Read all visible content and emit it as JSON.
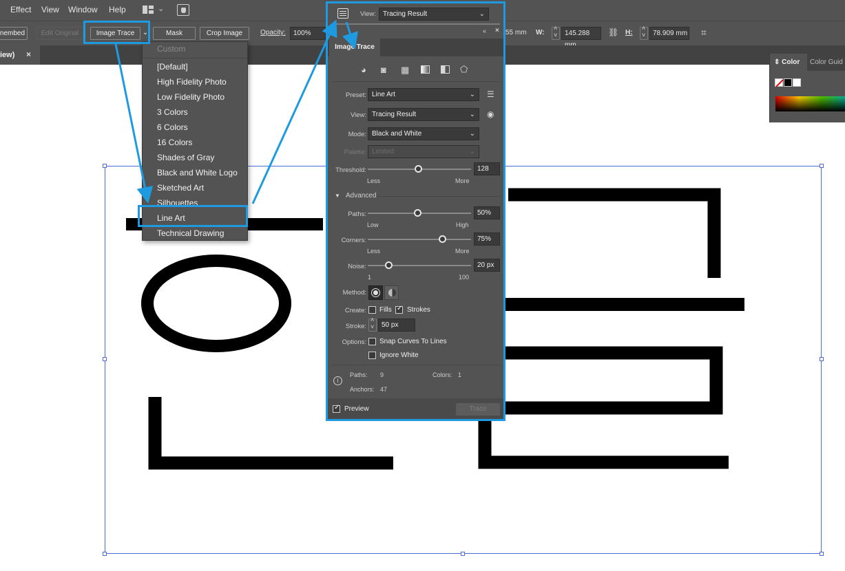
{
  "menubar": {
    "items": [
      "Effect",
      "View",
      "Window",
      "Help"
    ]
  },
  "control_bar": {
    "embed_label": "nembed",
    "edit_original_label": "Edit Original",
    "image_trace_label": "Image Trace",
    "mask_label": "Mask",
    "crop_label": "Crop Image",
    "opacity_label": "Opacity:",
    "opacity_value": "100%",
    "x_value": "55 mm",
    "w_label": "W:",
    "w_value": "145.288 mm",
    "h_label": "H:",
    "h_value": "78.909 mm"
  },
  "doc_tab": {
    "title": "iew)",
    "close": "×"
  },
  "preset_dropdown": {
    "items": [
      "Custom",
      "[Default]",
      "High Fidelity Photo",
      "Low Fidelity Photo",
      "3 Colors",
      "6 Colors",
      "16 Colors",
      "Shades of Gray",
      "Black and White Logo",
      "Sketched Art",
      "Silhouettes",
      "Line Art",
      "Technical Drawing"
    ],
    "selected": "Line Art"
  },
  "image_trace_panel": {
    "top_view_label": "View:",
    "top_view_value": "Tracing Result",
    "tab": "Image Trace",
    "preset_label": "Preset:",
    "preset_value": "Line Art",
    "view_label": "View:",
    "view_value": "Tracing Result",
    "mode_label": "Mode:",
    "mode_value": "Black and White",
    "palette_label": "Palette:",
    "palette_value": "Limited",
    "threshold_label": "Threshold:",
    "threshold_value": "128",
    "threshold_min": "Less",
    "threshold_max": "More",
    "advanced_label": "Advanced",
    "paths_label": "Paths:",
    "paths_value": "50%",
    "paths_min": "Low",
    "paths_max": "High",
    "corners_label": "Corners:",
    "corners_value": "75%",
    "corners_min": "Less",
    "corners_max": "More",
    "noise_label": "Noise:",
    "noise_value": "20 px",
    "noise_min": "1",
    "noise_max": "100",
    "method_label": "Method:",
    "create_label": "Create:",
    "fills_label": "Fills",
    "strokes_label": "Strokes",
    "fills_checked": false,
    "strokes_checked": true,
    "stroke_label": "Stroke:",
    "stroke_value": "50 px",
    "options_label": "Options:",
    "snap_label": "Snap Curves To Lines",
    "ignore_white_label": "Ignore White",
    "stats_paths_label": "Paths:",
    "stats_paths_value": "9",
    "stats_colors_label": "Colors:",
    "stats_colors_value": "1",
    "stats_anchors_label": "Anchors:",
    "stats_anchors_value": "47",
    "preview_label": "Preview",
    "preview_checked": true,
    "trace_label": "Trace",
    "slider_levels": {
      "threshold": 0.5,
      "paths": 0.5,
      "corners": 0.75,
      "noise": 0.2
    }
  },
  "color_panel": {
    "tab1": "Color",
    "tab2": "Color Guid"
  },
  "colors": {
    "highlight": "#1e9be0",
    "panel_bg": "#535353",
    "selection": "#4a6cd4"
  },
  "icons": [
    "workspace-icon",
    "hand-icon",
    "panel-menu-icon",
    "auto-color-icon",
    "camera-icon",
    "grid-icon",
    "gradient-icon",
    "half-icon",
    "outline-icon",
    "eye-icon",
    "info-icon",
    "constrain-icon",
    "transform-icon"
  ]
}
